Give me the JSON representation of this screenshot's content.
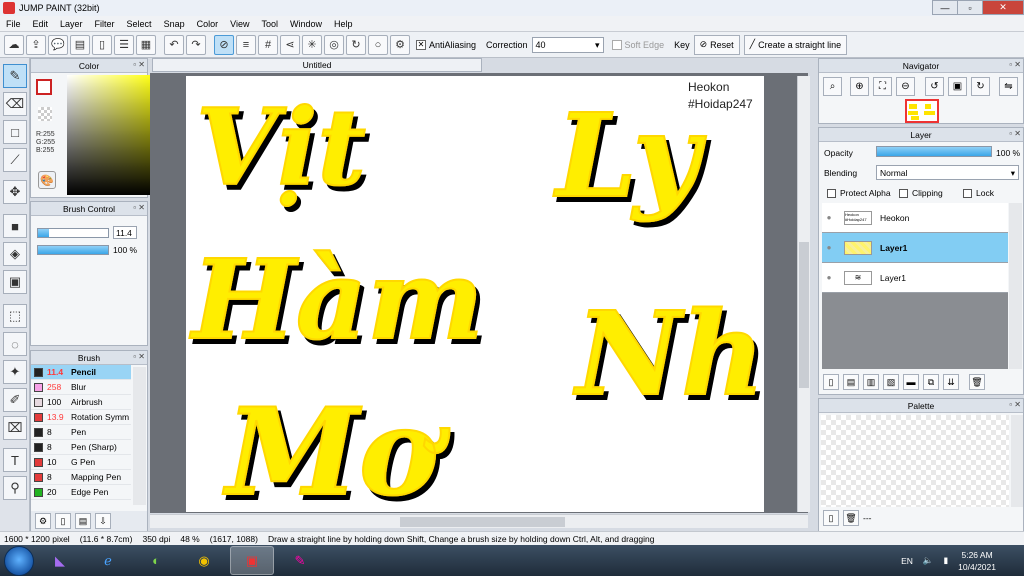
{
  "window": {
    "title": "JUMP PAINT (32bit)",
    "minimize": "—",
    "maximize": "▫",
    "close": "✕"
  },
  "menu": [
    "File",
    "Edit",
    "Layer",
    "Filter",
    "Select",
    "Snap",
    "Color",
    "View",
    "Tool",
    "Window",
    "Help"
  ],
  "toolbar": {
    "antialiasing_label": "AntiAliasing",
    "antialiasing_checked": "✕",
    "correction_label": "Correction",
    "correction_value": "40",
    "soft_edge_label": "Soft Edge",
    "key_label": "Key",
    "reset_label": "Reset",
    "straight_line_label": "Create a straight line"
  },
  "color_panel": {
    "title": "Color",
    "r": "R:255",
    "g": "G:255",
    "b": "B:255",
    "main_color": "#ffff00"
  },
  "brush_control": {
    "title": "Brush Control",
    "size_value": "11.4",
    "opacity_value": "100 %",
    "size_fraction": 0.15,
    "opacity_fraction": 1.0
  },
  "brush_panel": {
    "title": "Brush",
    "brushes": [
      {
        "size": "11.4",
        "name": "Pencil",
        "color": "#ff3a3a",
        "swatch": "#222222"
      },
      {
        "size": "258",
        "name": "Blur",
        "color": "#ff3a3a",
        "swatch": "#f7a1e6"
      },
      {
        "size": "100",
        "name": "Airbrush",
        "color": "#000000",
        "swatch": "#e6d9e0"
      },
      {
        "size": "13.9",
        "name": "Rotation Symm",
        "color": "#ff3a3a",
        "swatch": "#e33b3b"
      },
      {
        "size": "8",
        "name": "Pen",
        "color": "#000000",
        "swatch": "#222222"
      },
      {
        "size": "8",
        "name": "Pen (Sharp)",
        "color": "#000000",
        "swatch": "#222222"
      },
      {
        "size": "10",
        "name": "G Pen",
        "color": "#000000",
        "swatch": "#e33b3b"
      },
      {
        "size": "8",
        "name": "Mapping Pen",
        "color": "#000000",
        "swatch": "#e33b3b"
      },
      {
        "size": "20",
        "name": "Edge Pen",
        "color": "#000000",
        "swatch": "#22b322"
      }
    ]
  },
  "document": {
    "tab_title": "Untitled"
  },
  "canvas": {
    "watermark_line1": "Heokon",
    "watermark_line2": "#Hoidap247",
    "words": [
      "Vịt",
      "Hàm",
      "Mơ",
      "Ly",
      "Nhớ"
    ]
  },
  "navigator": {
    "title": "Navigator"
  },
  "layer_panel": {
    "title": "Layer",
    "opacity_label": "Opacity",
    "opacity_value": "100 %",
    "blending_label": "Blending",
    "blending_value": "Normal",
    "protect_alpha_label": "Protect Alpha",
    "clipping_label": "Clipping",
    "lock_label": "Lock",
    "layers": [
      {
        "name": "Heokon",
        "thumb": "Heokon #Hoidap247"
      },
      {
        "name": "Layer1",
        "thumb": ""
      },
      {
        "name": "Layer1",
        "thumb": ""
      }
    ]
  },
  "palette": {
    "title": "Palette",
    "extra": "---"
  },
  "status": {
    "pixels": "1600 * 1200 pixel",
    "cm": "(11.6 * 8.7cm)",
    "dpi": "350 dpi",
    "zoom": "48 %",
    "coords": "(1617, 1088)",
    "hint": "Draw a straight line by holding down Shift, Change a brush size by holding down Ctrl, Alt, and dragging"
  },
  "taskbar": {
    "language": "EN",
    "time": "5:26 AM",
    "date": "10/4/2021"
  }
}
